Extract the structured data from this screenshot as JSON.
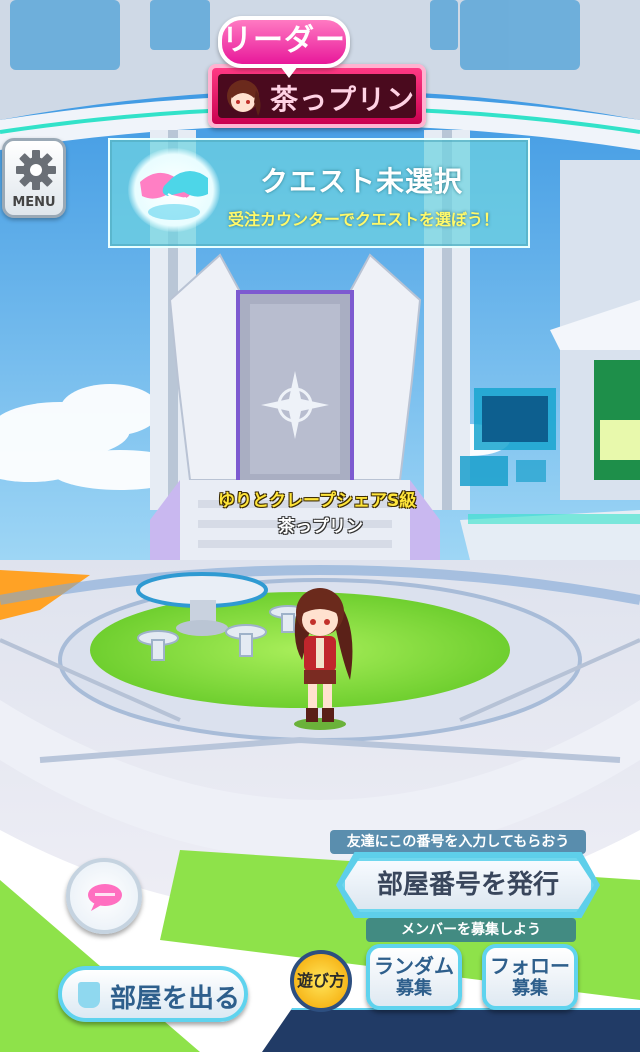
{
  "leader": {
    "tag": "リーダー",
    "name": "茶っプリン"
  },
  "menu": {
    "label": "MENU",
    "icon": "gear-icon"
  },
  "quest": {
    "icon": "handshake-icon",
    "title": "クエスト未選択",
    "subtitle": "受注カウンターでクエストを選ぼう！"
  },
  "player": {
    "title": "ゆりとクレープシェアS級",
    "name": "茶っプリン"
  },
  "room": {
    "hint_number": "友達にこの番号を入力してもらおう",
    "issue_number_label": "部屋番号を発行",
    "hint_recruit": "メンバーを募集しよう",
    "random_line1": "ランダム",
    "random_line2": "募集",
    "follow_line1": "フォロー",
    "follow_line2": "募集",
    "how_to_play": "遊び方",
    "leave_label": "部屋を出る"
  },
  "colors": {
    "accent_pink": "#e8189a",
    "accent_cyan": "#5fd3ee",
    "floor_green": "#8ee24a",
    "title_yellow": "#ffe53a"
  }
}
